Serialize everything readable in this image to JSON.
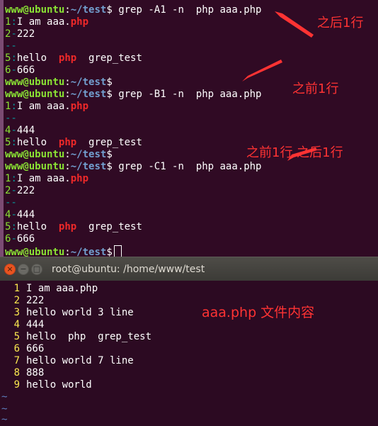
{
  "terminal": {
    "prompt_user": "www@ubuntu",
    "prompt_path": "~/test",
    "prompt_symbol": "$",
    "commands": {
      "a1": "grep -A1 -n  php aaa.php",
      "b1": "grep -B1 -n  php aaa.php",
      "c1": "grep -C1 -n  php aaa.php"
    },
    "output": {
      "l1_num": "1",
      "l1_text": "I am aaa.",
      "l1_match": "php",
      "l2_num": "2",
      "l2_text": "222",
      "l4_num": "4",
      "l4_text": "444",
      "l5_num": "5",
      "l5_text_a": "hello  ",
      "l5_match": "php",
      "l5_text_b": "  grep_test",
      "l6_num": "6",
      "l6_text": "666",
      "group_sep": "--",
      "colon": ":",
      "dash": "-"
    }
  },
  "annotations": {
    "after1": "之后1行",
    "before1": "之前1行",
    "context1": "之前1行 之后1行",
    "file_content": "aaa.php 文件内容"
  },
  "window": {
    "title": "root@ubuntu: /home/www/test",
    "close_glyph": "×",
    "min_glyph": "−",
    "max_glyph": "□"
  },
  "vim": {
    "lines": [
      {
        "num": "1",
        "text": "I am aaa.php"
      },
      {
        "num": "2",
        "text": "222"
      },
      {
        "num": "3",
        "text": "hello world 3 line"
      },
      {
        "num": "4",
        "text": "444"
      },
      {
        "num": "5",
        "text": "hello  php  grep_test"
      },
      {
        "num": "6",
        "text": "666"
      },
      {
        "num": "7",
        "text": "hello world 7 line"
      },
      {
        "num": "8",
        "text": "888"
      },
      {
        "num": "9",
        "text": "hello world"
      }
    ],
    "tilde": "~"
  },
  "colors": {
    "terminal_bg": "#300a24",
    "prompt_green": "#8ae234",
    "prompt_blue": "#729fcf",
    "match_red": "#ef2929",
    "annotation_red": "#ff3333",
    "vim_number_yellow": "#fce94f"
  }
}
